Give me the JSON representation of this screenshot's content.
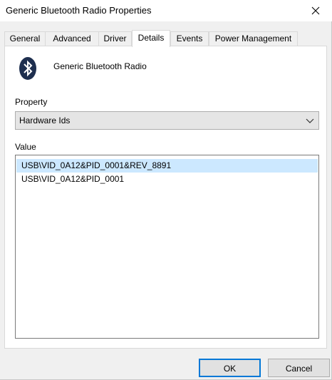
{
  "window": {
    "title": "Generic Bluetooth Radio Properties"
  },
  "tabs": [
    {
      "label": "General"
    },
    {
      "label": "Advanced"
    },
    {
      "label": "Driver"
    },
    {
      "label": "Details",
      "active": true
    },
    {
      "label": "Events"
    },
    {
      "label": "Power Management"
    }
  ],
  "device": {
    "icon": "bluetooth-icon",
    "name": "Generic Bluetooth Radio"
  },
  "property": {
    "label": "Property",
    "selected": "Hardware Ids"
  },
  "value": {
    "label": "Value",
    "items": [
      {
        "text": "USB\\VID_0A12&PID_0001&REV_8891",
        "selected": true
      },
      {
        "text": "USB\\VID_0A12&PID_0001",
        "selected": false
      }
    ]
  },
  "buttons": {
    "ok": "OK",
    "cancel": "Cancel"
  },
  "colors": {
    "selection": "#cce8ff",
    "accent": "#0078d7",
    "bluetooth": "#1e2f4f"
  }
}
